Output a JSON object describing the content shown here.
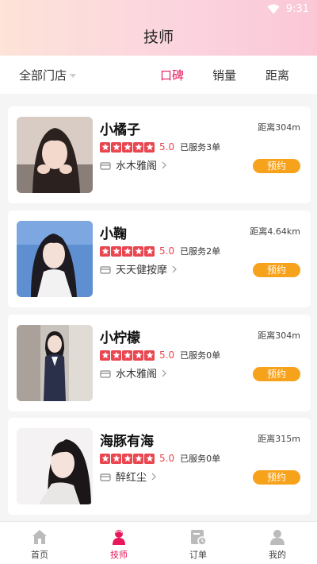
{
  "status_bar": {
    "time": "9:31"
  },
  "header": {
    "title": "技师"
  },
  "filter": {
    "store_select": "全部门店",
    "sort_tabs": [
      "口碑",
      "销量",
      "距离"
    ],
    "active_sort": "口碑"
  },
  "therapists": [
    {
      "name": "小橘子",
      "distance": "距离304m",
      "rating": "5.0",
      "served": "已服务3单",
      "store": "水木雅阁",
      "book": "预约"
    },
    {
      "name": "小鞠",
      "distance": "距离4.64km",
      "rating": "5.0",
      "served": "已服务2单",
      "store": "天天健按摩",
      "book": "预约"
    },
    {
      "name": "小柠檬",
      "distance": "距离304m",
      "rating": "5.0",
      "served": "已服务0单",
      "store": "水木雅阁",
      "book": "预约"
    },
    {
      "name": "海豚有海",
      "distance": "距离315m",
      "rating": "5.0",
      "served": "已服务0单",
      "store": "醉红尘",
      "book": "预约"
    }
  ],
  "tabbar": {
    "items": [
      {
        "label": "首页",
        "icon": "home-icon"
      },
      {
        "label": "技师",
        "icon": "therapist-icon"
      },
      {
        "label": "订单",
        "icon": "order-icon"
      },
      {
        "label": "我的",
        "icon": "profile-icon"
      }
    ],
    "active": "技师"
  },
  "colors": {
    "accent": "#e8185b",
    "star": "#e94650",
    "button": "#f7a21b"
  }
}
